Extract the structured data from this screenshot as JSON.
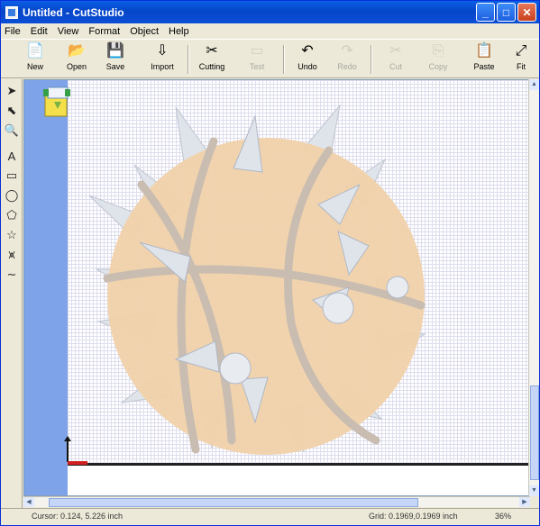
{
  "window": {
    "title": "Untitled - CutStudio"
  },
  "title_buttons": {
    "minimize": "_",
    "maximize": "□",
    "close": "✕"
  },
  "menu": [
    "File",
    "Edit",
    "View",
    "Format",
    "Object",
    "Help"
  ],
  "toolbar": [
    {
      "label": "New",
      "icon": "📄",
      "icon_name": "new-document-icon",
      "enabled": true
    },
    {
      "label": "Open",
      "icon": "📂",
      "icon_name": "open-folder-icon",
      "enabled": true
    },
    {
      "label": "Save",
      "icon": "💾",
      "icon_name": "save-disk-icon",
      "enabled": true
    },
    {
      "label": "Import",
      "icon": "⇩",
      "icon_name": "import-icon",
      "enabled": true
    },
    {
      "label": "Cutting",
      "icon": "✂",
      "icon_name": "cutting-icon",
      "enabled": true
    },
    {
      "label": "Test",
      "icon": "▭",
      "icon_name": "test-icon",
      "enabled": false
    },
    {
      "label": "Undo",
      "icon": "↶",
      "icon_name": "undo-icon",
      "enabled": true
    },
    {
      "label": "Redo",
      "icon": "↷",
      "icon_name": "redo-icon",
      "enabled": false
    },
    {
      "label": "Cut",
      "icon": "✂",
      "icon_name": "cut-icon",
      "enabled": false
    },
    {
      "label": "Copy",
      "icon": "⎘",
      "icon_name": "copy-icon",
      "enabled": false
    },
    {
      "label": "Paste",
      "icon": "📋",
      "icon_name": "paste-icon",
      "enabled": true
    },
    {
      "label": "Fit",
      "icon": "⤢",
      "icon_name": "fit-icon",
      "enabled": true
    }
  ],
  "left_tools": [
    {
      "icon": "➤",
      "name": "select-arrow-icon"
    },
    {
      "icon": "⬉",
      "name": "edit-points-icon"
    },
    {
      "icon": "🔍",
      "name": "zoom-icon"
    },
    {
      "icon": "A",
      "name": "text-tool-icon"
    },
    {
      "icon": "▭",
      "name": "rectangle-tool-icon"
    },
    {
      "icon": "◯",
      "name": "ellipse-tool-icon"
    },
    {
      "icon": "⬠",
      "name": "polygon-tool-icon"
    },
    {
      "icon": "☆",
      "name": "star-tool-icon"
    },
    {
      "icon": "⩙",
      "name": "bezier-tool-icon"
    },
    {
      "icon": "∼",
      "name": "freehand-tool-icon"
    }
  ],
  "status": {
    "cursor": "Cursor: 0.124, 5.226 inch",
    "grid": "Grid: 0.1969,0.1969 inch",
    "zoom": "36%"
  },
  "colors": {
    "canvas_margin": "#7ea3e8",
    "ball": "#f0d2aa",
    "seam": "#c9bcb0",
    "spike": "#dfe3ea"
  }
}
